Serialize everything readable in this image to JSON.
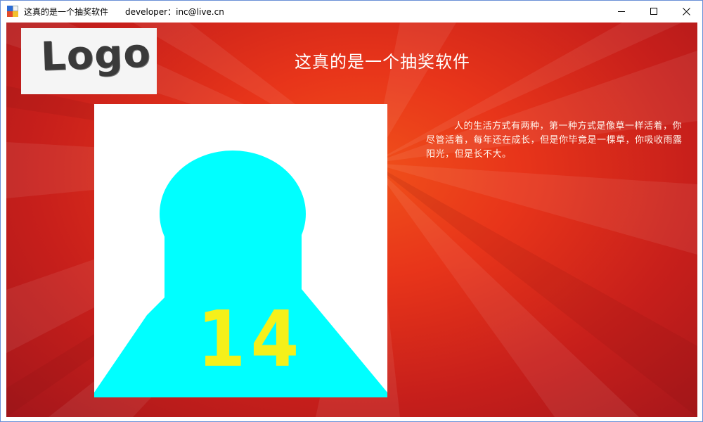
{
  "window": {
    "title": "这真的是一个抽奖软件",
    "developer": "developer：inc@live.cn",
    "controls": {
      "minimize_icon": "minimize-icon",
      "maximize_icon": "maximize-icon",
      "close_icon": "close-icon"
    }
  },
  "main": {
    "logo_text": "Logo",
    "app_title": "这真的是一个抽奖软件",
    "photo": {
      "number": "14",
      "figure_color": "#00ffff",
      "number_color": "#f5f01a"
    },
    "quote": "人的生活方式有两种，第一种方式是像草一样活着，你尽管活着，每年还在成长，但是你毕竟是一棵草，你吸收雨露阳光，但是长不大。"
  },
  "colors": {
    "background_red": "#c71f1b",
    "background_orange": "#f0511a"
  }
}
